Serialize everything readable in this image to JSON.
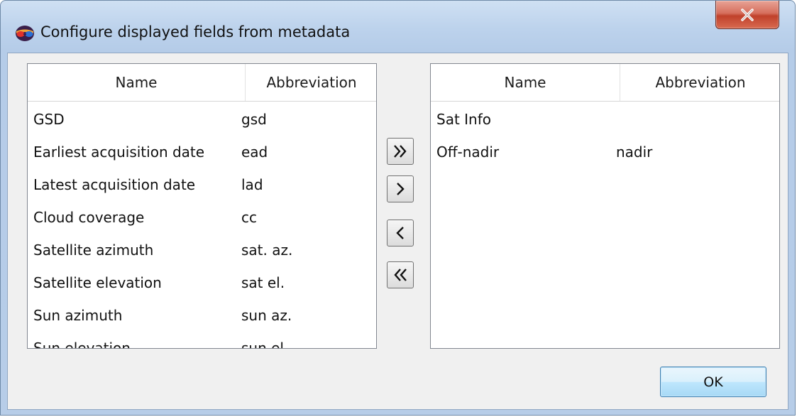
{
  "window": {
    "title": "Configure displayed fields from metadata",
    "close_icon": "close-x-icon",
    "app_icon": "3d-glasses-icon"
  },
  "available_list": {
    "headers": {
      "name": "Name",
      "abbreviation": "Abbreviation"
    },
    "rows": [
      {
        "name": "GSD",
        "abbreviation": "gsd"
      },
      {
        "name": "Earliest acquisition date",
        "abbreviation": "ead"
      },
      {
        "name": "Latest acquisition date",
        "abbreviation": "lad"
      },
      {
        "name": "Cloud coverage",
        "abbreviation": "cc"
      },
      {
        "name": "Satellite azimuth",
        "abbreviation": "sat. az."
      },
      {
        "name": "Satellite elevation",
        "abbreviation": "sat el."
      },
      {
        "name": "Sun azimuth",
        "abbreviation": "sun az."
      },
      {
        "name": "Sun elevation",
        "abbreviation": "sun el."
      }
    ]
  },
  "selected_list": {
    "headers": {
      "name": "Name",
      "abbreviation": "Abbreviation"
    },
    "rows": [
      {
        "name": "Sat Info",
        "abbreviation": ""
      },
      {
        "name": "Off-nadir",
        "abbreviation": "nadir"
      }
    ]
  },
  "transfer_buttons": {
    "add_all_icon": "double-chevron-right-icon",
    "add_one_icon": "chevron-right-icon",
    "remove_one_icon": "chevron-left-icon",
    "remove_all_icon": "double-chevron-left-icon"
  },
  "footer": {
    "ok_label": "OK"
  },
  "colors": {
    "title_bar": "#bcd2ec",
    "close_button": "#c7503a",
    "client_background": "#f0f0f0",
    "ok_button": "#bee6fd"
  }
}
